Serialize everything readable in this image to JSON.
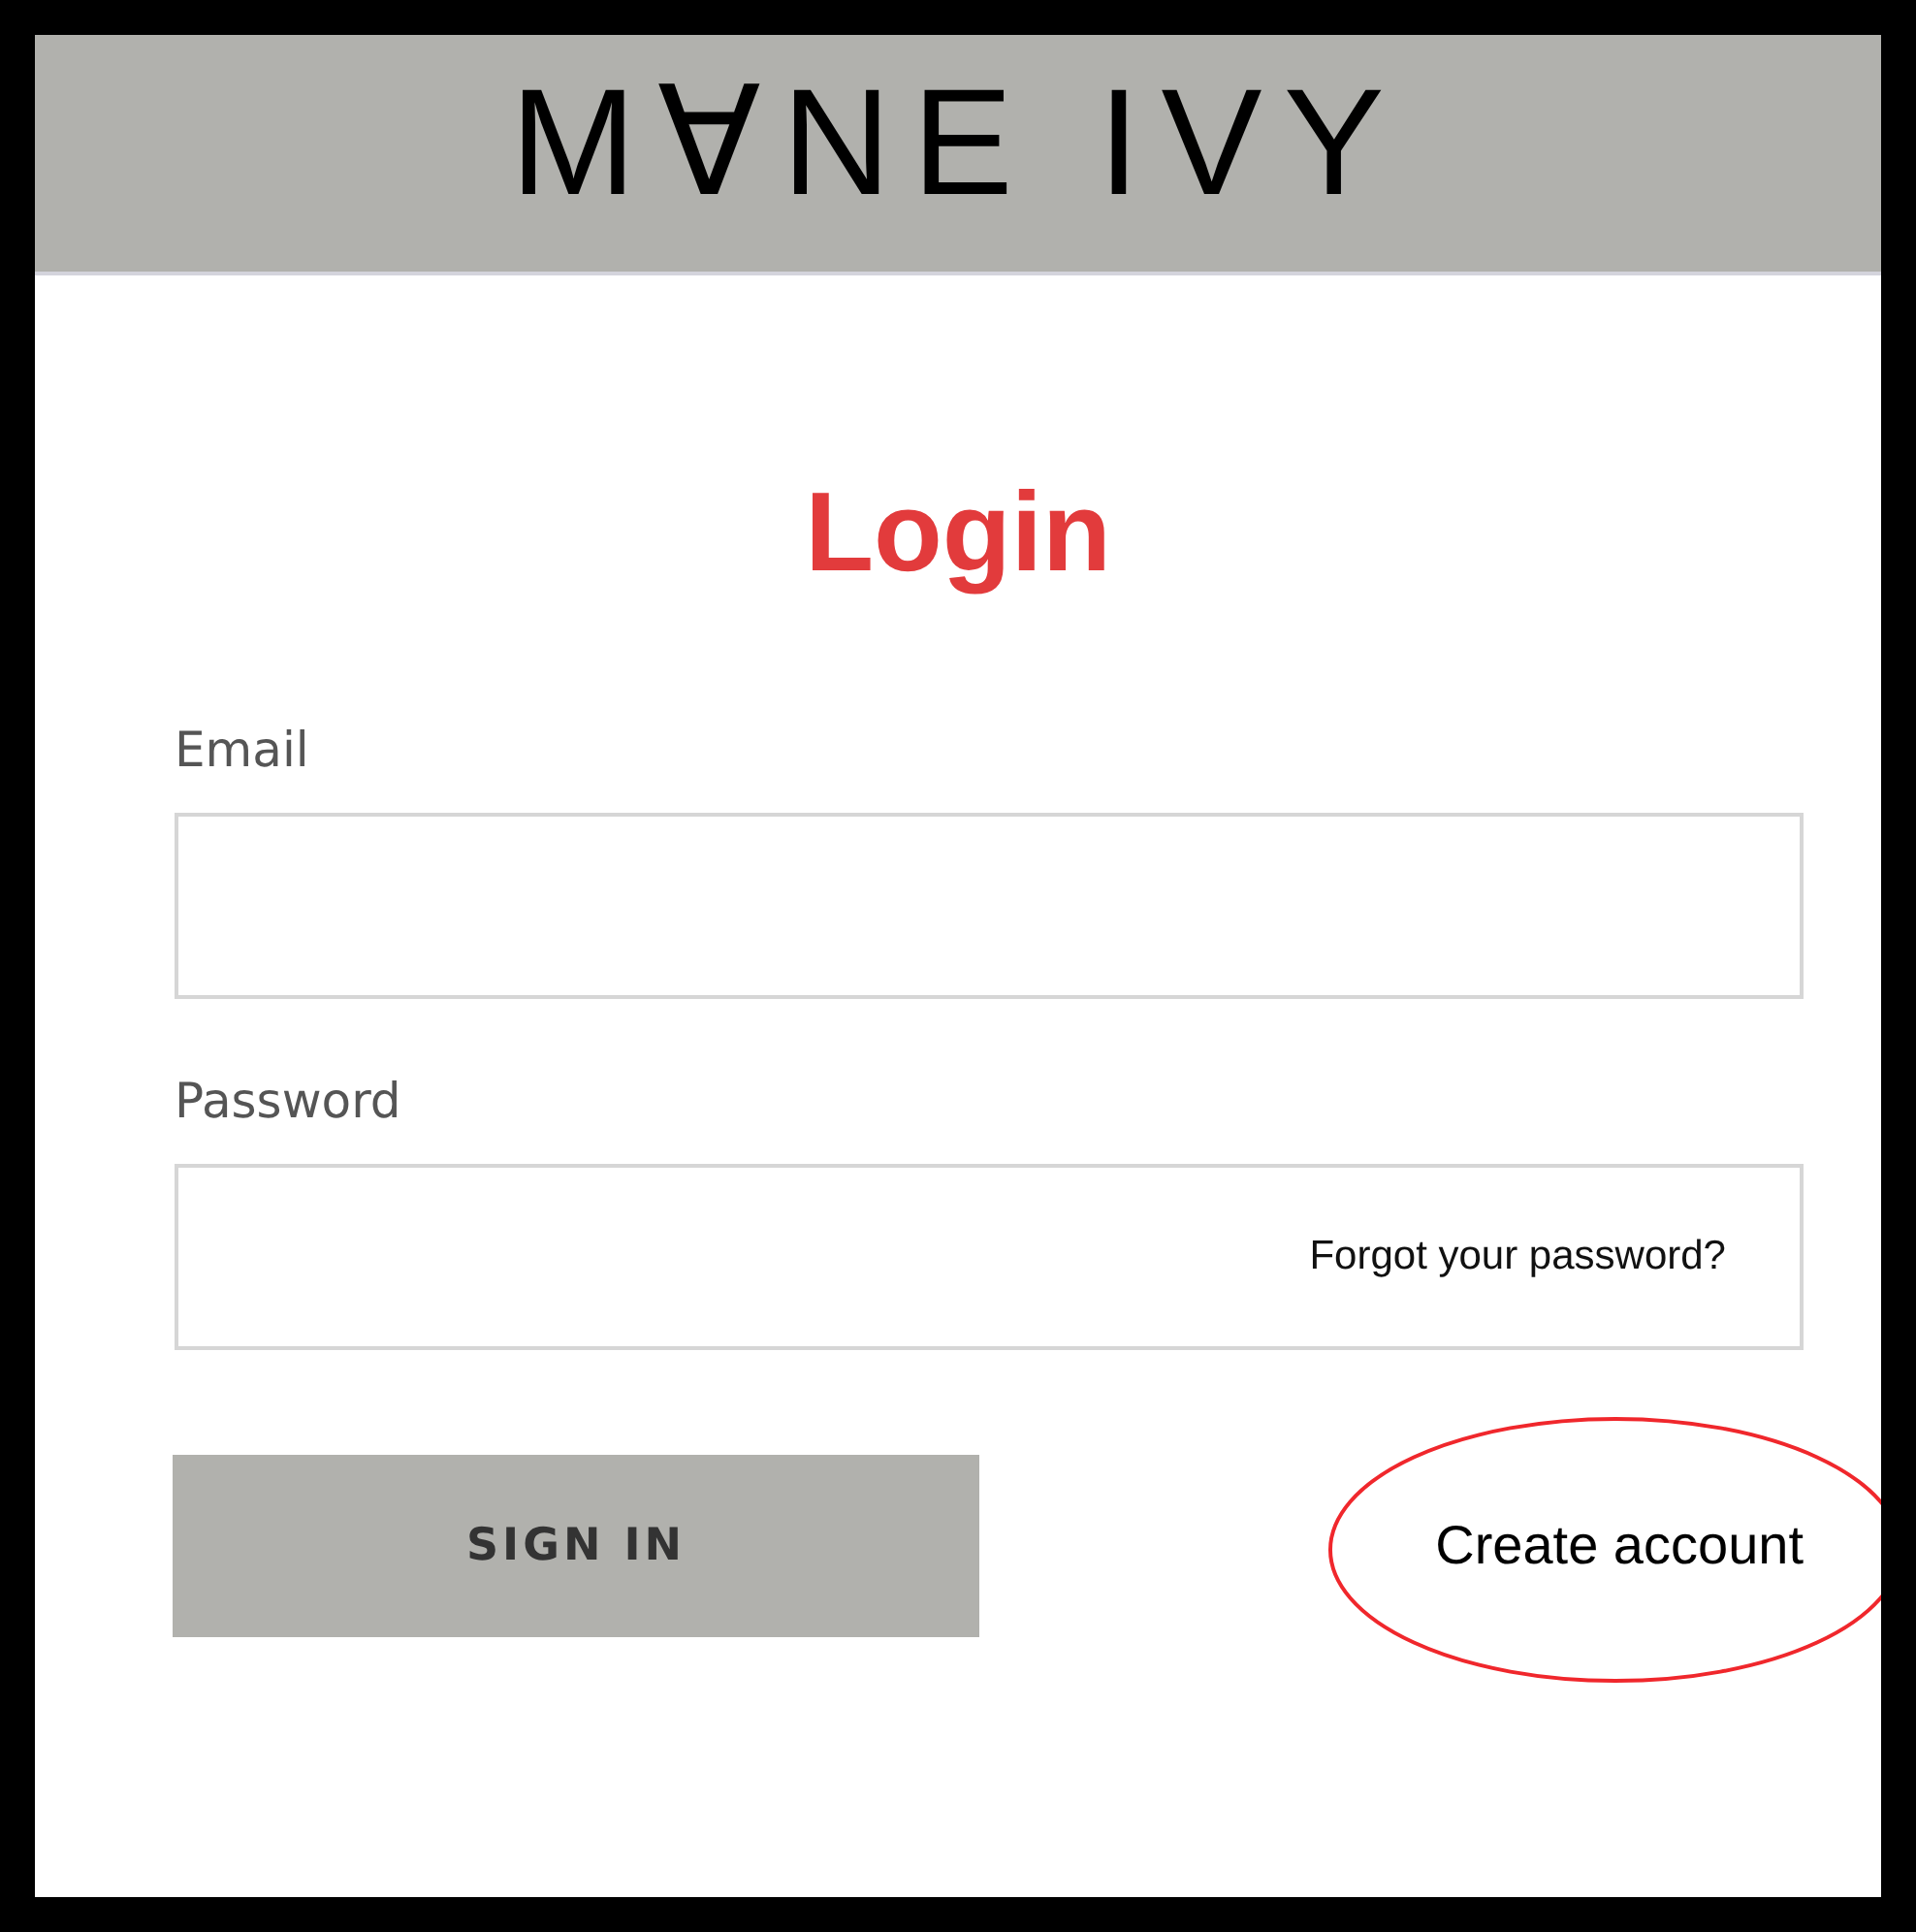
{
  "header": {
    "logo": "M∀NE IVY"
  },
  "title": "Login",
  "fields": [
    {
      "label": "Email"
    },
    {
      "label": "Password",
      "link": "Forgot your password?"
    }
  ],
  "sign_in_button": "SIGN IN",
  "create_account": {
    "label": "Create account",
    "circled": true
  }
}
